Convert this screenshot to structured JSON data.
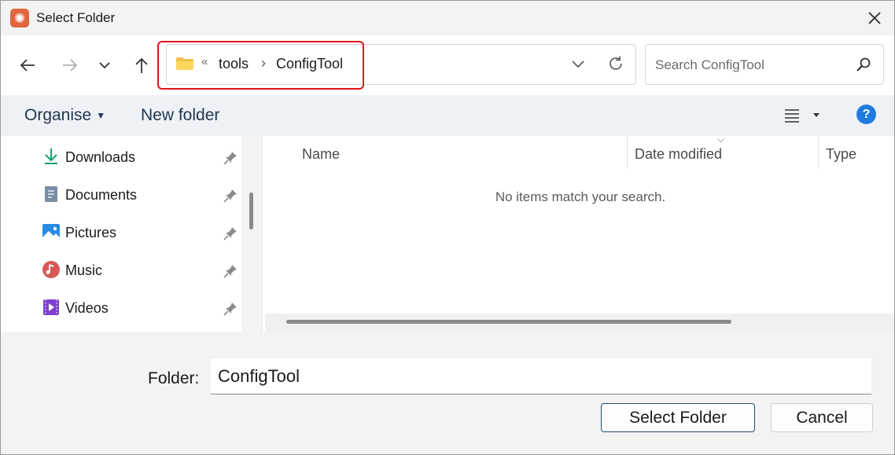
{
  "window": {
    "title": "Select Folder",
    "close_icon": "close-icon"
  },
  "navigation": {
    "back_icon": "arrow-left-icon",
    "forward_icon": "arrow-right-icon",
    "recent_icon": "chevron-down-icon",
    "up_icon": "arrow-up-icon"
  },
  "address_bar": {
    "overflow": "«",
    "crumbs": [
      "tools",
      "ConfigTool"
    ],
    "folder_icon": "folder-icon",
    "dropdown_icon": "chevron-down-icon",
    "refresh_icon": "refresh-icon",
    "highlight_color": "#e0141c"
  },
  "search": {
    "placeholder": "Search ConfigTool",
    "icon": "search-icon"
  },
  "command_bar": {
    "organise_label": "Organise",
    "new_folder_label": "New folder",
    "view_icon": "list-view-icon",
    "help_icon": "help-icon",
    "help_glyph": "?"
  },
  "sidebar": {
    "items": [
      {
        "label": "Downloads",
        "icon": "download-icon",
        "pinned": true
      },
      {
        "label": "Documents",
        "icon": "document-icon",
        "pinned": true
      },
      {
        "label": "Pictures",
        "icon": "pictures-icon",
        "pinned": true
      },
      {
        "label": "Music",
        "icon": "music-icon",
        "pinned": true
      },
      {
        "label": "Videos",
        "icon": "videos-icon",
        "pinned": true
      }
    ]
  },
  "file_list": {
    "columns": [
      "Name",
      "Date modified",
      "Type"
    ],
    "sorted_column": "Date modified",
    "empty_message": "No items match your search."
  },
  "footer": {
    "folder_label": "Folder:",
    "folder_value": "ConfigTool",
    "select_label": "Select Folder",
    "cancel_label": "Cancel"
  },
  "colors": {
    "accent": "#1e7be0",
    "command_bar_bg": "#eef2f7",
    "app_icon": "#e0663d"
  }
}
